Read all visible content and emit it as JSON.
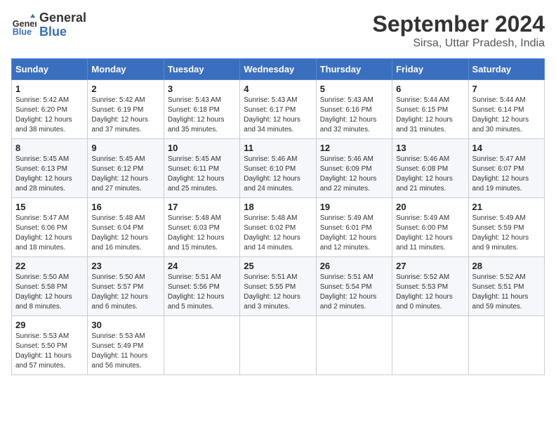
{
  "header": {
    "logo_line1": "General",
    "logo_line2": "Blue",
    "month": "September 2024",
    "location": "Sirsa, Uttar Pradesh, India"
  },
  "weekdays": [
    "Sunday",
    "Monday",
    "Tuesday",
    "Wednesday",
    "Thursday",
    "Friday",
    "Saturday"
  ],
  "weeks": [
    [
      {
        "day": "1",
        "info": "Sunrise: 5:42 AM\nSunset: 6:20 PM\nDaylight: 12 hours\nand 38 minutes."
      },
      {
        "day": "2",
        "info": "Sunrise: 5:42 AM\nSunset: 6:19 PM\nDaylight: 12 hours\nand 37 minutes."
      },
      {
        "day": "3",
        "info": "Sunrise: 5:43 AM\nSunset: 6:18 PM\nDaylight: 12 hours\nand 35 minutes."
      },
      {
        "day": "4",
        "info": "Sunrise: 5:43 AM\nSunset: 6:17 PM\nDaylight: 12 hours\nand 34 minutes."
      },
      {
        "day": "5",
        "info": "Sunrise: 5:43 AM\nSunset: 6:16 PM\nDaylight: 12 hours\nand 32 minutes."
      },
      {
        "day": "6",
        "info": "Sunrise: 5:44 AM\nSunset: 6:15 PM\nDaylight: 12 hours\nand 31 minutes."
      },
      {
        "day": "7",
        "info": "Sunrise: 5:44 AM\nSunset: 6:14 PM\nDaylight: 12 hours\nand 30 minutes."
      }
    ],
    [
      {
        "day": "8",
        "info": "Sunrise: 5:45 AM\nSunset: 6:13 PM\nDaylight: 12 hours\nand 28 minutes."
      },
      {
        "day": "9",
        "info": "Sunrise: 5:45 AM\nSunset: 6:12 PM\nDaylight: 12 hours\nand 27 minutes."
      },
      {
        "day": "10",
        "info": "Sunrise: 5:45 AM\nSunset: 6:11 PM\nDaylight: 12 hours\nand 25 minutes."
      },
      {
        "day": "11",
        "info": "Sunrise: 5:46 AM\nSunset: 6:10 PM\nDaylight: 12 hours\nand 24 minutes."
      },
      {
        "day": "12",
        "info": "Sunrise: 5:46 AM\nSunset: 6:09 PM\nDaylight: 12 hours\nand 22 minutes."
      },
      {
        "day": "13",
        "info": "Sunrise: 5:46 AM\nSunset: 6:08 PM\nDaylight: 12 hours\nand 21 minutes."
      },
      {
        "day": "14",
        "info": "Sunrise: 5:47 AM\nSunset: 6:07 PM\nDaylight: 12 hours\nand 19 minutes."
      }
    ],
    [
      {
        "day": "15",
        "info": "Sunrise: 5:47 AM\nSunset: 6:06 PM\nDaylight: 12 hours\nand 18 minutes."
      },
      {
        "day": "16",
        "info": "Sunrise: 5:48 AM\nSunset: 6:04 PM\nDaylight: 12 hours\nand 16 minutes."
      },
      {
        "day": "17",
        "info": "Sunrise: 5:48 AM\nSunset: 6:03 PM\nDaylight: 12 hours\nand 15 minutes."
      },
      {
        "day": "18",
        "info": "Sunrise: 5:48 AM\nSunset: 6:02 PM\nDaylight: 12 hours\nand 14 minutes."
      },
      {
        "day": "19",
        "info": "Sunrise: 5:49 AM\nSunset: 6:01 PM\nDaylight: 12 hours\nand 12 minutes."
      },
      {
        "day": "20",
        "info": "Sunrise: 5:49 AM\nSunset: 6:00 PM\nDaylight: 12 hours\nand 11 minutes."
      },
      {
        "day": "21",
        "info": "Sunrise: 5:49 AM\nSunset: 5:59 PM\nDaylight: 12 hours\nand 9 minutes."
      }
    ],
    [
      {
        "day": "22",
        "info": "Sunrise: 5:50 AM\nSunset: 5:58 PM\nDaylight: 12 hours\nand 8 minutes."
      },
      {
        "day": "23",
        "info": "Sunrise: 5:50 AM\nSunset: 5:57 PM\nDaylight: 12 hours\nand 6 minutes."
      },
      {
        "day": "24",
        "info": "Sunrise: 5:51 AM\nSunset: 5:56 PM\nDaylight: 12 hours\nand 5 minutes."
      },
      {
        "day": "25",
        "info": "Sunrise: 5:51 AM\nSunset: 5:55 PM\nDaylight: 12 hours\nand 3 minutes."
      },
      {
        "day": "26",
        "info": "Sunrise: 5:51 AM\nSunset: 5:54 PM\nDaylight: 12 hours\nand 2 minutes."
      },
      {
        "day": "27",
        "info": "Sunrise: 5:52 AM\nSunset: 5:53 PM\nDaylight: 12 hours\nand 0 minutes."
      },
      {
        "day": "28",
        "info": "Sunrise: 5:52 AM\nSunset: 5:51 PM\nDaylight: 11 hours\nand 59 minutes."
      }
    ],
    [
      {
        "day": "29",
        "info": "Sunrise: 5:53 AM\nSunset: 5:50 PM\nDaylight: 11 hours\nand 57 minutes."
      },
      {
        "day": "30",
        "info": "Sunrise: 5:53 AM\nSunset: 5:49 PM\nDaylight: 11 hours\nand 56 minutes."
      },
      {
        "day": "",
        "info": ""
      },
      {
        "day": "",
        "info": ""
      },
      {
        "day": "",
        "info": ""
      },
      {
        "day": "",
        "info": ""
      },
      {
        "day": "",
        "info": ""
      }
    ]
  ]
}
